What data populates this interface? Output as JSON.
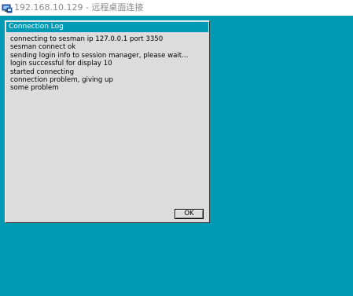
{
  "window": {
    "title": "192.168.10.129 - 远程桌面连接",
    "icon": "remote-desktop-icon"
  },
  "desktop": {
    "background_color": "#009ab5"
  },
  "dialog": {
    "title": "Connection Log",
    "lines": [
      "connecting to sesman ip 127.0.0.1 port 3350",
      "sesman connect ok",
      "sending login info to session manager, please wait...",
      "login successful for display 10",
      "started connecting",
      "connection problem, giving up",
      "some problem"
    ],
    "ok_label": "OK"
  }
}
